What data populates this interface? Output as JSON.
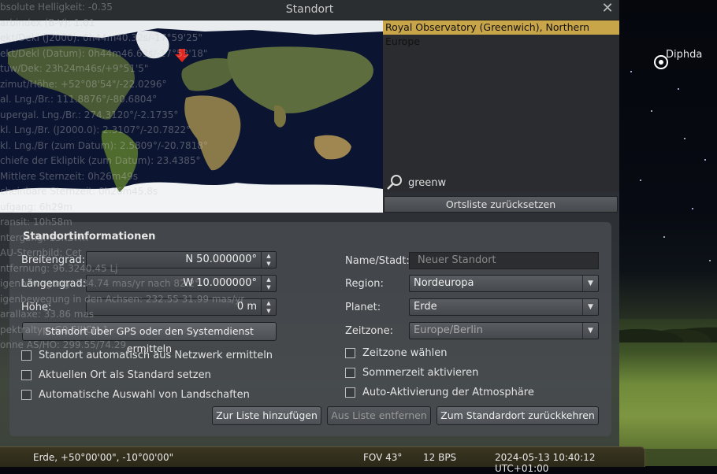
{
  "window": {
    "title": "Standort"
  },
  "sky": {
    "star_label": "Diphda"
  },
  "info_overlay": [
    "bsolute Helligkeit: -0.35",
    "arbindex (B-V): 1.01",
    "ekt/Dekl (J2000): 0h44m40.32s/-17°59'25\"",
    "ekt/Dekl (Datum): 0h44m46.63s/-17°53'18\"",
    "tuw/Dek: 23h24m46s/+9°51'5\"",
    "zimut/Höhe: +52°08'54\"/-22.0296°",
    "al. Lng./Br.: 111.8876°/-80.6804°",
    "upergal. Lng./Br.: 274.3120°/-2.1735°",
    "kl. Lng./Br. (J2000.0): 2.3107°/-20.7822°",
    "kl. Lng./Br (zum Datum): 2.5809°/-20.7818°",
    "chiefe der Ekliptik (zum Datum): 23.4385°",
    "Mittlere Sternzeit: 0h26m49s",
    "cheinbare Sternzeit: 0h26m45.8s",
    "ufgang: 6h29m",
    "ransit: 10h58m",
    "ntergang: 15h27m",
    "AU-Sternbild: Cet",
    "ntfernung: 96.3240.45 Lj",
    "igenbewegung: 234.74 mas/yr nach 82.2°",
    "igenbewegung in den Achsen: 232.55 31.99 mas/yr",
    "arallaxe: 33.86 mas",
    "pektraltyp: G9.5IIICH-1",
    "onne AS/HO: 299.55/74.29"
  ],
  "map": {
    "marker": "location-marker"
  },
  "location_list": {
    "selected_item": "Royal Observatory (Greenwich), Northern Europe",
    "search_value": "greenw",
    "reset_button": "Ortsliste zurücksetzen"
  },
  "info": {
    "section_title": "Standortinformationen",
    "latitude_label": "Breitengrad:",
    "latitude_value": "N 50.000000°",
    "longitude_label": "Längengrad:",
    "longitude_value": "W 10.000000°",
    "altitude_label": "Höhe:",
    "altitude_value": "0 m",
    "gps_button": "Standort über GPS oder den Systemdienst ermitteln",
    "checkboxes_left": [
      "Standort automatisch aus Netzwerk ermitteln",
      "Aktuellen Ort als Standard setzen",
      "Automatische Auswahl von Landschaften"
    ],
    "name_label": "Name/Stadt:",
    "name_placeholder": "Neuer Standort",
    "region_label": "Region:",
    "region_value": "Nordeuropa",
    "planet_label": "Planet:",
    "planet_value": "Erde",
    "timezone_label": "Zeitzone:",
    "timezone_value": "Europe/Berlin",
    "checkboxes_right": [
      "Zeitzone wählen",
      "Sommerzeit aktivieren",
      "Auto-Aktivierung der Atmosphäre"
    ],
    "add_button": "Zur Liste hinzufügen",
    "remove_button": "Aus Liste entfernen",
    "default_button": "Zum Standardort zurückkehren"
  },
  "statusbar": {
    "location": "Erde, +50°00'00\", -10°00'00\"",
    "fov": "FOV 43°",
    "fps": "12 BPS",
    "datetime": "2024-05-13 10:40:12 UTC+01:00"
  }
}
